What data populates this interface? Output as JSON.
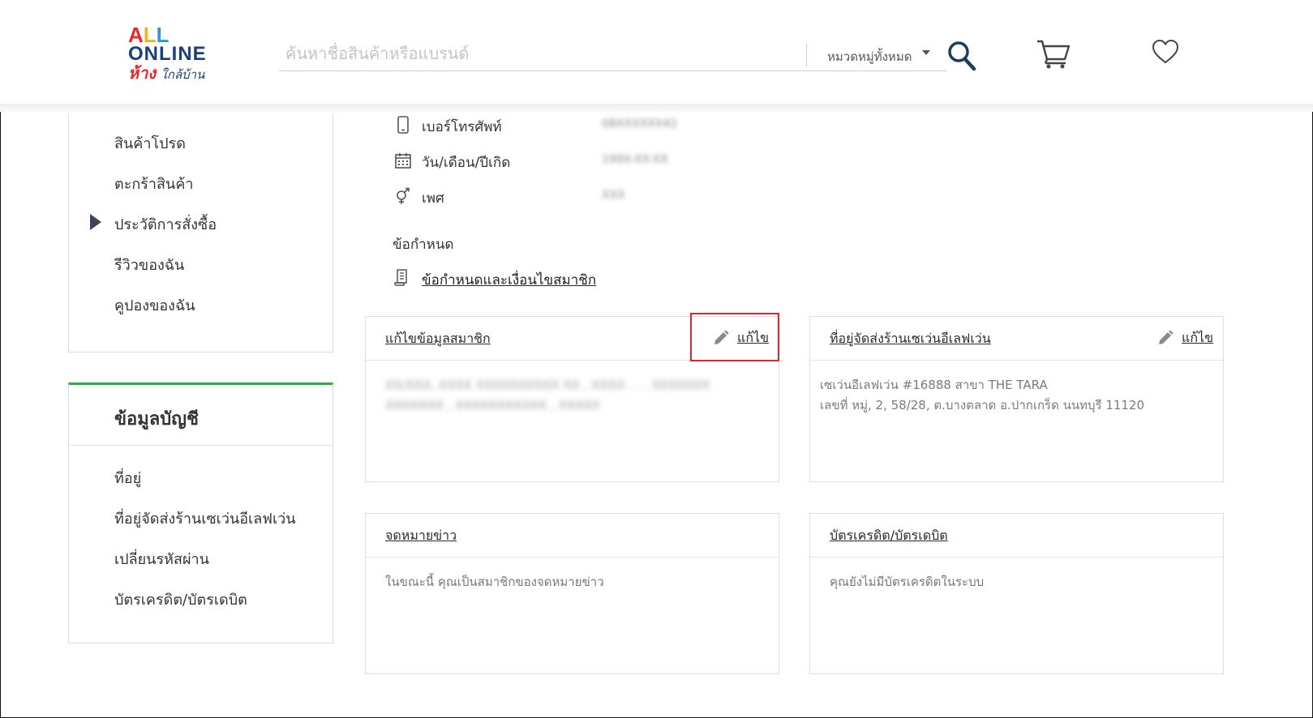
{
  "header": {
    "logo": {
      "line1": "ALL",
      "line2": "ONLINE",
      "line3_red": "ห้าง",
      "line3_blue": "ใกล้บ้าน"
    },
    "search": {
      "placeholder": "ค้นหาชื่อสินค้าหรือแบรนด์",
      "category": "หมวดหมู่ทั้งหมด"
    }
  },
  "sidebar": {
    "items": [
      {
        "label": "สินค้าโปรด"
      },
      {
        "label": "ตะกร้าสินค้า"
      },
      {
        "label": "ประวัติการสั่งซื้อ",
        "active": true
      },
      {
        "label": "รีวิวของฉัน"
      },
      {
        "label": "คูปองของฉัน"
      }
    ],
    "account": {
      "title": "ข้อมูลบัญชี",
      "items": [
        {
          "label": "ที่อยู่"
        },
        {
          "label": "ที่อยู่จัดส่งร้านเซเว่นอีเลฟเว่น"
        },
        {
          "label": "เปลี่ยนรหัสผ่าน"
        },
        {
          "label": "บัตรเครดิต/บัตรเดบิต"
        }
      ]
    },
    "accent_color": "#27b344"
  },
  "profile": {
    "rows": [
      {
        "label": "เบอร์โทรศัพท์",
        "value": "08XXXXXX42"
      },
      {
        "label": "วัน/เดือน/ปีเกิด",
        "value": "199X-XX-XX"
      },
      {
        "label": "เพศ",
        "value": "XXX"
      }
    ],
    "terms_heading": "ข้อกำหนด",
    "terms_link": "ข้อกำหนดและเงื่อนไขสมาชิก"
  },
  "cards": {
    "member": {
      "title": "แก้ไขข้อมูลสมาชิก",
      "edit": "แก้ไข",
      "line1": "XX/XXX, XXXX XXXXXXXXXX XX , XXXX . . . XXXXXXX",
      "line2": "XXXXXXX , XXXXXXXXXXX , XXXXX"
    },
    "seven": {
      "title": "ที่อยู่จัดส่งร้านเซเว่นอีเลฟเว่น",
      "edit": "แก้ไข",
      "line1": "เซเว่นอีเลฟเว่น #16888 สาขา THE TARA",
      "line2": "เลขที่ หมู่, 2, 58/28, ต.บางตลาด อ.ปากเกร็ด นนทบุรี 11120"
    },
    "newsletter": {
      "title": "จดหมายข่าว",
      "body": "ในขณะนี้ คุณเป็นสมาชิกของจดหมายข่าว"
    },
    "card": {
      "title": "บัตรเครดิต/บัตรเดบิต",
      "body": "คุณยังไม่มีบัตรเครดิตในระบบ"
    }
  },
  "highlight_color": "#e0242b"
}
